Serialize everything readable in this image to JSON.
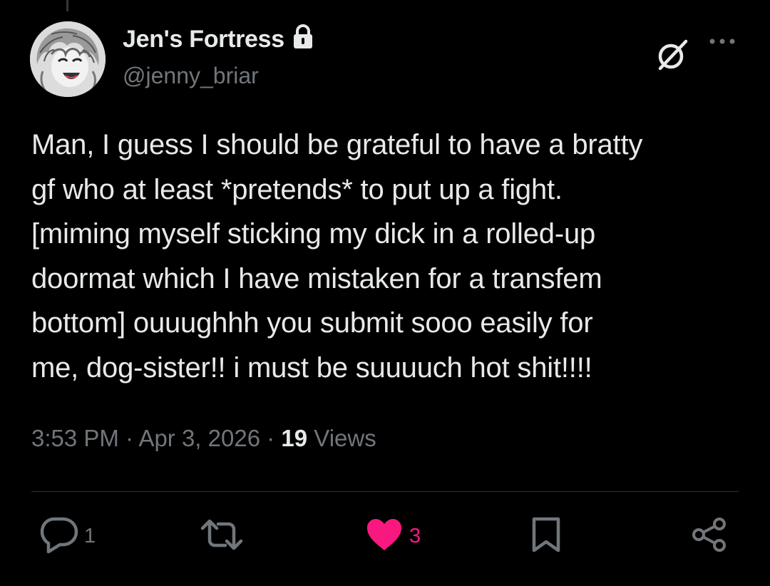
{
  "author": {
    "display_name": "Jen's Fortress",
    "handle": "@jenny_briar",
    "protected": true
  },
  "post": {
    "text": "Man, I guess I should be grateful to have a bratty\ngf who at least *pretends* to put up a fight.\n[miming myself sticking my dick in a rolled-up\ndoormat which I have mistaken for a transfem\nbottom] ouuughhh you submit sooo easily for\nme, dog-sister!! i must be suuuuch hot shit!!!!",
    "time": "3:53 PM",
    "separator": "·",
    "date": "Apr 3, 2026",
    "views_count": "19",
    "views_label": "Views"
  },
  "actions": {
    "reply_count": "1",
    "like_count": "3",
    "liked": true
  },
  "colors": {
    "background": "#000000",
    "text": "#e7e9ea",
    "muted": "#71767b",
    "like": "#f91880",
    "divider": "#2f3336"
  },
  "icons": {
    "protected": "lock-icon",
    "grok": "grok-icon",
    "more": "more-icon",
    "reply": "reply-icon",
    "repost": "repost-icon",
    "like": "heart-icon",
    "bookmark": "bookmark-icon",
    "share": "share-icon"
  }
}
